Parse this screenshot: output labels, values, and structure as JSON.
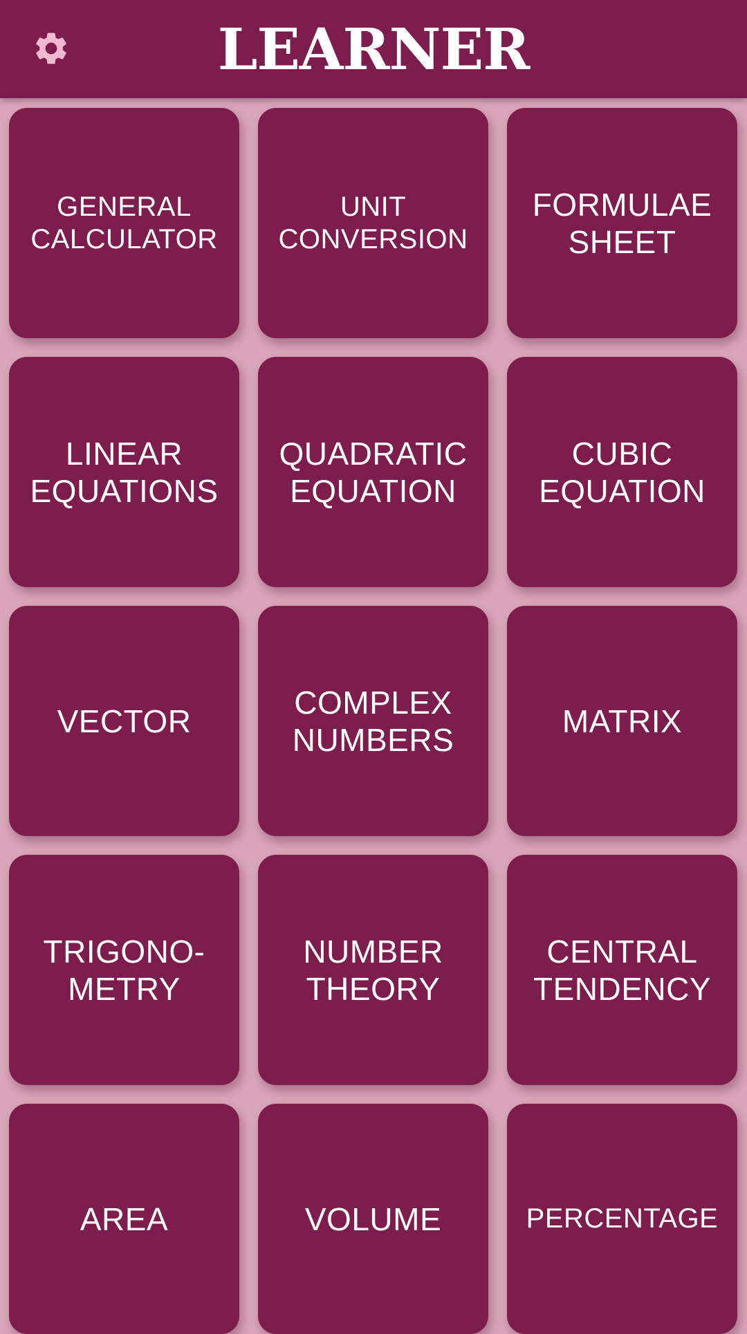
{
  "app": {
    "title": "LEARNER",
    "settings_icon": "gear-icon",
    "colors": {
      "primary": "#7d1d4d",
      "background": "#d9a6b9",
      "icon": "#f2b8d0",
      "text": "#ffffff"
    }
  },
  "tiles": [
    {
      "label": "GENERAL\nCALCULATOR"
    },
    {
      "label": "UNIT\nCONVERSION"
    },
    {
      "label": "FORMULAE\nSHEET"
    },
    {
      "label": "LINEAR\nEQUATIONS"
    },
    {
      "label": "QUADRATIC\nEQUATION"
    },
    {
      "label": "CUBIC\nEQUATION"
    },
    {
      "label": "VECTOR"
    },
    {
      "label": "COMPLEX\nNUMBERS"
    },
    {
      "label": "MATRIX"
    },
    {
      "label": "TRIGONO-\nMETRY"
    },
    {
      "label": "NUMBER\nTHEORY"
    },
    {
      "label": "CENTRAL\nTENDENCY"
    },
    {
      "label": "AREA"
    },
    {
      "label": "VOLUME"
    },
    {
      "label": "PERCENTAGE"
    }
  ]
}
